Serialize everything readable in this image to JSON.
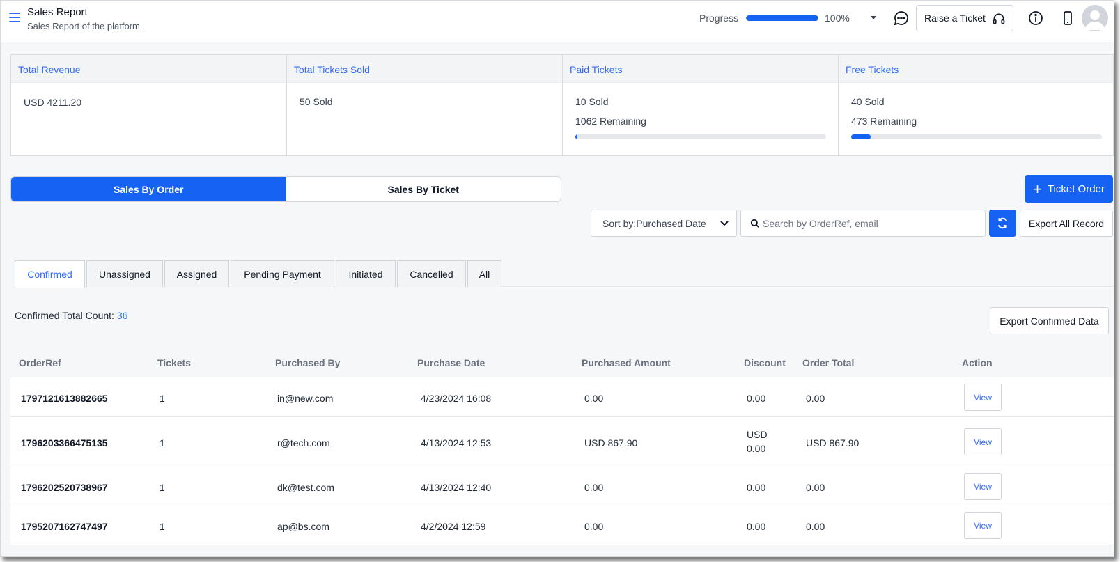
{
  "header": {
    "title": "Sales Report",
    "subtitle": "Sales Report of the platform.",
    "progress_label": "Progress",
    "progress_percent_text": "100%",
    "progress_fraction": 1.0,
    "raise_ticket_label": "Raise a Ticket",
    "icons": [
      "menu-icon",
      "chat-icon",
      "headset-icon",
      "info-icon",
      "mobile-icon",
      "avatar"
    ]
  },
  "stats": [
    {
      "title": "Total Revenue",
      "lines": [
        "USD 4211.20"
      ]
    },
    {
      "title": "Total Tickets Sold",
      "lines": [
        "50 Sold"
      ]
    },
    {
      "title": "Paid Tickets",
      "lines": [
        "10 Sold",
        "1062 Remaining"
      ],
      "sold_fraction": 0.009
    },
    {
      "title": "Free Tickets",
      "lines": [
        "40 Sold",
        "473 Remaining"
      ],
      "sold_fraction": 0.078
    }
  ],
  "view_toggle": {
    "options": [
      "Sales By Order",
      "Sales By Ticket"
    ],
    "active": "Sales By Order"
  },
  "ticket_order_label": "Ticket Order",
  "sort": {
    "value": "Sort by:Purchased Date"
  },
  "search": {
    "placeholder": "Search by OrderRef, email",
    "value": ""
  },
  "export_all_label": "Export All Record",
  "status_tabs": [
    "Confirmed",
    "Unassigned",
    "Assigned",
    "Pending Payment",
    "Initiated",
    "Cancelled",
    "All"
  ],
  "active_status_tab": "Confirmed",
  "count": {
    "label": "Confirmed Total Count:",
    "value": "36"
  },
  "export_confirmed_label": "Export Confirmed Data",
  "table": {
    "columns": [
      "OrderRef",
      "Tickets",
      "Purchased By",
      "Purchase Date",
      "Purchased Amount",
      "Discount",
      "Order Total",
      "Action"
    ],
    "rows": [
      {
        "order_ref": "1797121613882665",
        "tickets": "1",
        "purchased_by": "in@new.com",
        "purchase_date": "4/23/2024 16:08",
        "purchased_amount": "0.00",
        "discount": "0.00",
        "order_total": "0.00",
        "action": "View"
      },
      {
        "order_ref": "1796203366475135",
        "tickets": "1",
        "purchased_by": "r@tech.com",
        "purchase_date": "4/13/2024 12:53",
        "purchased_amount": "USD 867.90",
        "discount": "USD 0.00",
        "order_total": "USD 867.90",
        "action": "View"
      },
      {
        "order_ref": "1796202520738967",
        "tickets": "1",
        "purchased_by": "dk@test.com",
        "purchase_date": "4/13/2024 12:40",
        "purchased_amount": "0.00",
        "discount": "0.00",
        "order_total": "0.00",
        "action": "View"
      },
      {
        "order_ref": "1795207162747497",
        "tickets": "1",
        "purchased_by": "ap@bs.com",
        "purchase_date": "4/2/2024 12:59",
        "purchased_amount": "0.00",
        "discount": "0.00",
        "order_total": "0.00",
        "action": "View"
      }
    ]
  },
  "colors": {
    "accent": "#1663f3",
    "link": "#2f6bff",
    "background": "#f6f7f9"
  }
}
